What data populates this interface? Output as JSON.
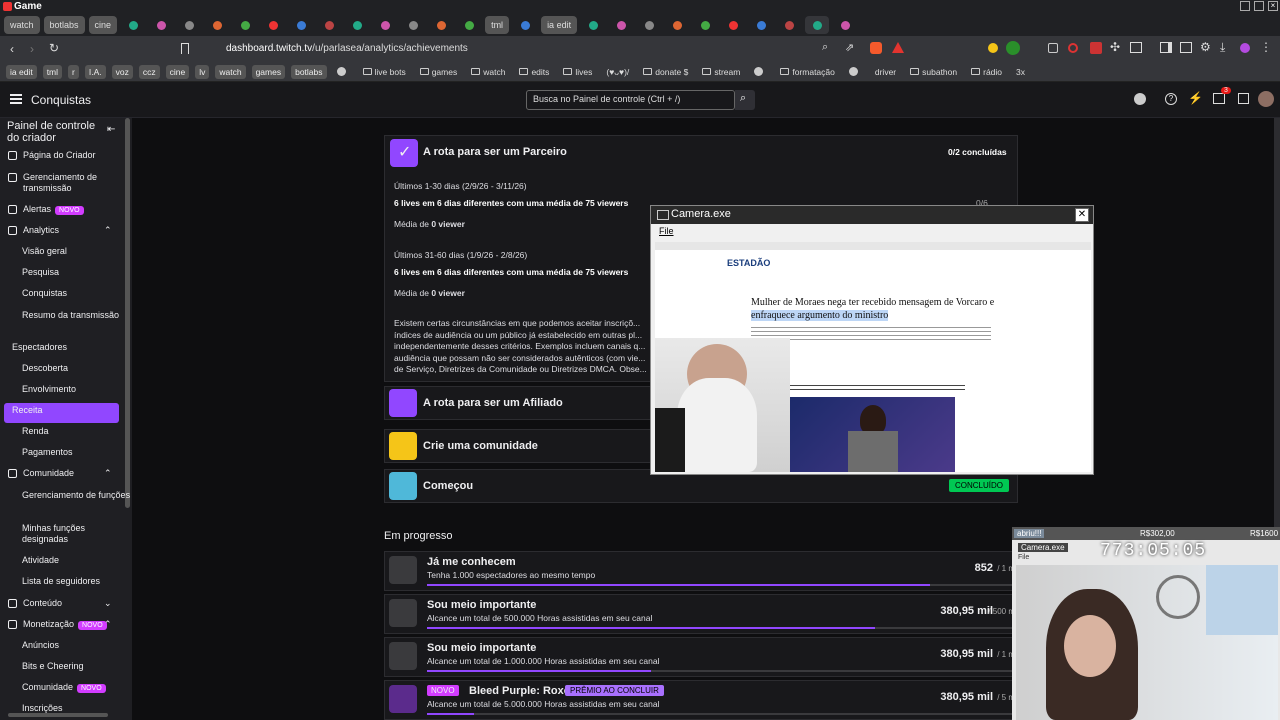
{
  "window": {
    "title": "Game"
  },
  "tabs": {
    "items": [
      {
        "label": "watch",
        "type": "label"
      },
      {
        "label": "botlabs",
        "type": "label"
      },
      {
        "label": "cine",
        "type": "label"
      },
      {
        "label": "G",
        "type": "icon"
      },
      {
        "label": "U",
        "type": "icon"
      },
      {
        "label": "Gr",
        "type": "icon"
      },
      {
        "label": "N",
        "type": "icon"
      },
      {
        "label": "C",
        "type": "icon"
      },
      {
        "label": "N",
        "type": "icon"
      },
      {
        "label": "A",
        "type": "icon"
      },
      {
        "label": "Tr",
        "type": "icon"
      },
      {
        "label": "C",
        "type": "icon"
      },
      {
        "label": "D",
        "type": "icon"
      },
      {
        "label": "N",
        "type": "icon"
      },
      {
        "label": "C",
        "type": "icon"
      },
      {
        "label": "N",
        "type": "icon"
      },
      {
        "label": "tml",
        "type": "label"
      },
      {
        "label": "h",
        "type": "icon"
      },
      {
        "label": "ia edit",
        "type": "label"
      },
      {
        "label": "B",
        "type": "icon"
      },
      {
        "label": "n",
        "type": "icon"
      },
      {
        "label": "C",
        "type": "icon"
      },
      {
        "label": "D",
        "type": "icon"
      },
      {
        "label": "(I",
        "type": "icon"
      },
      {
        "label": "a",
        "type": "icon"
      },
      {
        "label": "C",
        "type": "icon"
      },
      {
        "label": "C",
        "type": "icon"
      },
      {
        "label": "G",
        "type": "active"
      },
      {
        "label": "G",
        "type": "icon"
      }
    ]
  },
  "address": {
    "host": "dashboard.twitch.tv",
    "path": "/u/parlasea/analytics/achievements"
  },
  "bookmarks": [
    {
      "label": "ia edit",
      "pill": true
    },
    {
      "label": "tml",
      "pill": true
    },
    {
      "label": "r",
      "pill": true
    },
    {
      "label": "I.A.",
      "pill": true
    },
    {
      "label": "voz",
      "pill": true
    },
    {
      "label": "ccz",
      "pill": true
    },
    {
      "label": "cine",
      "pill": true
    },
    {
      "label": "lv",
      "pill": true
    },
    {
      "label": "watch",
      "pill": true
    },
    {
      "label": "games",
      "pill": true
    },
    {
      "label": "botlabs",
      "pill": true
    },
    {
      "label": "",
      "pill": false
    },
    {
      "label": "live bots",
      "pill": false,
      "folder": true
    },
    {
      "label": "games",
      "pill": false,
      "folder": true
    },
    {
      "label": "watch",
      "pill": false,
      "folder": true
    },
    {
      "label": "edits",
      "pill": false,
      "folder": true
    },
    {
      "label": "lives",
      "pill": false,
      "folder": true
    },
    {
      "label": "(♥ᴗ♥)/",
      "pill": false
    },
    {
      "label": "donate $",
      "pill": false,
      "folder": true
    },
    {
      "label": "stream",
      "pill": false,
      "folder": true
    },
    {
      "label": "",
      "pill": false
    },
    {
      "label": "formatação",
      "pill": false,
      "folder": true
    },
    {
      "label": "",
      "pill": false
    },
    {
      "label": "driver",
      "pill": false
    },
    {
      "label": "subathon",
      "pill": false,
      "folder": true
    },
    {
      "label": "rádio",
      "pill": false,
      "folder": true
    },
    {
      "label": "3x",
      "pill": false
    }
  ],
  "header": {
    "section": "Conquistas",
    "search_placeholder": "Busca no Painel de controle (Ctrl + /)",
    "notif_count": "3"
  },
  "sidebar": {
    "title": "Painel de controle do criador",
    "items": [
      {
        "label": "Página do Criador"
      },
      {
        "label": "Gerenciamento de transmissão"
      },
      {
        "label": "Alertas",
        "badge": "NOVO"
      },
      {
        "label": "Analytics"
      },
      {
        "label": "Visão geral"
      },
      {
        "label": "Pesquisa"
      },
      {
        "label": "Conquistas"
      },
      {
        "label": "Resumo da transmissão"
      },
      {
        "label": "Espectadores"
      },
      {
        "label": "Descoberta"
      },
      {
        "label": "Envolvimento"
      },
      {
        "label": "Receita"
      },
      {
        "label": "Renda"
      },
      {
        "label": "Pagamentos"
      },
      {
        "label": "Comunidade"
      },
      {
        "label": "Gerenciamento de funções"
      },
      {
        "label": "Minhas funções designadas"
      },
      {
        "label": "Atividade"
      },
      {
        "label": "Lista de seguidores"
      },
      {
        "label": "Conteúdo"
      },
      {
        "label": "Monetização",
        "badge": "NOVO"
      },
      {
        "label": "Anúncios"
      },
      {
        "label": "Bits e Cheering"
      },
      {
        "label": "Comunidade",
        "badge": "NOVO"
      },
      {
        "label": "Inscrições"
      }
    ]
  },
  "partner": {
    "title": "A rota para ser um Parceiro",
    "status": "0/2 concluídas",
    "period1": "Últimos 1-30 dias (2/9/26 - 3/11/26)",
    "req1": "6 lives em 6 dias diferentes com uma média de 75 viewers",
    "avg_label": "Média de",
    "avg1": "0 viewer",
    "count1": "0/6",
    "period2": "Últimos 31-60 dias (1/9/26 - 2/8/26)",
    "req2": "6 lives em 6 dias diferentes com uma média de 75 viewers",
    "avg2": "0 viewer",
    "note": "Existem certas circunstâncias em que podemos aceitar inscriçõ... índices de audiência ou um público já estabelecido em outras pl... independentemente desses critérios. Exemplos incluem canais q... audiência que possam não ser considerados autênticos (com vie... de Serviço, Diretrizes da Comunidade ou Diretrizes DMCA. Obse..."
  },
  "achievements": [
    {
      "title": "A rota para ser um Afiliado",
      "color": "#9147ff"
    },
    {
      "title": "Crie uma comunidade",
      "color": "#f5c518"
    },
    {
      "title": "Começou",
      "color": "#4fb8d9",
      "done": "CONCLUÍDO"
    }
  ],
  "progress": {
    "heading": "Em progresso",
    "items": [
      {
        "title": "Já me conhecem",
        "desc": "Tenha 1.000 espectadores ao mesmo tempo",
        "value": "852",
        "of": "/ 1 m",
        "fill": 0.852
      },
      {
        "title": "Sou meio importante",
        "desc": "Alcance um total de 500.000 Horas assistidas em seu canal",
        "value": "380,95 mil",
        "of": "/ 500 m",
        "fill": 0.76
      },
      {
        "title": "Sou meio importante",
        "desc": "Alcance um total de 1.000.000 Horas assistidas em seu canal",
        "value": "380,95 mil",
        "of": "/ 1 m",
        "fill": 0.38
      },
      {
        "title": "Bleed Purple: Roxo",
        "desc": "Alcance um total de 5.000.000 Horas assistidas em seu canal",
        "value": "380,95 mil",
        "of": "/ 5 m",
        "fill": 0.08,
        "new": "NOVO",
        "prize": "PRÊMIO AO CONCLUIR"
      }
    ]
  },
  "camera": {
    "title": "Camera.exe",
    "menu": "File",
    "news_brand": "ESTADÃO",
    "headline_plain": "Mulher de Moraes nega ter recebido mensagem de Vorcaro e ",
    "headline_hl": "enfraquece argumento do ministro"
  },
  "stream": {
    "left": "abriu!!!",
    "mid": "R$302,00",
    "right": "R$1600",
    "subtitle": "Camera.exe",
    "sub2": "File",
    "timer": "773:05:05"
  }
}
